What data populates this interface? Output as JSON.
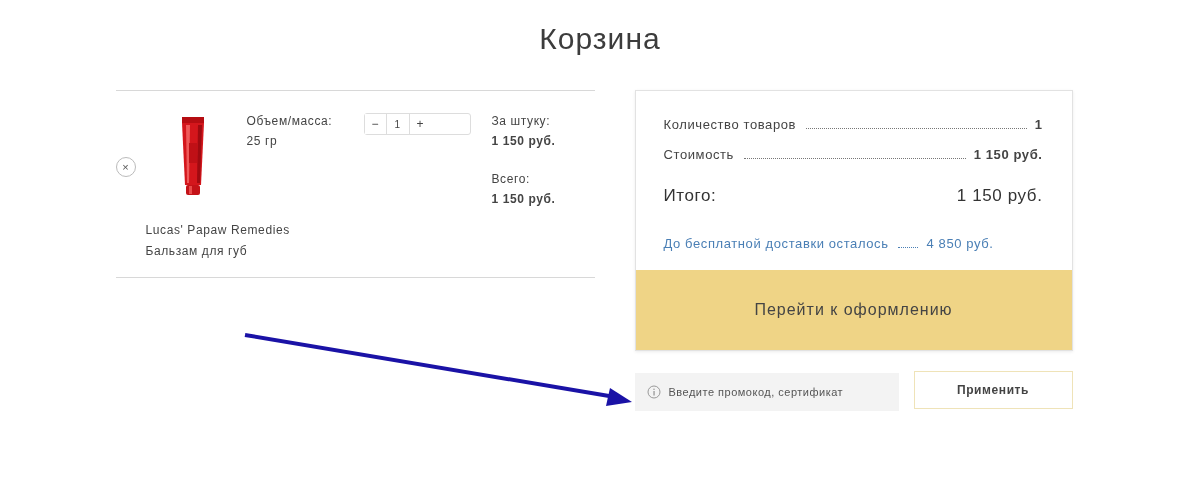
{
  "title": "Корзина",
  "cart_items": [
    {
      "remove": "×",
      "name": "Lucas' Papaw Remedies",
      "description": "Бальзам для губ",
      "attribute_label": "Объем/масса:",
      "attribute_value": "25 гр",
      "decrement": "−",
      "quantity": "1",
      "increment": "+",
      "unit_price_label": "За штуку:",
      "unit_price": "1 150 руб.",
      "total_label": "Всего:",
      "total": "1 150 руб."
    }
  ],
  "summary": {
    "rows": [
      {
        "label": "Количество товаров",
        "value": "1"
      },
      {
        "label": "Стоимость",
        "value": "1 150 руб."
      }
    ],
    "total_label": "Итого:",
    "total": "1 150 руб.",
    "free_delivery": {
      "label": "До бесплатной доставки осталось",
      "value": "4 850 руб."
    },
    "checkout_button": "Перейти к оформлению"
  },
  "promo": {
    "placeholder": "Введите промокод, сертификат",
    "apply_button": "Применить"
  }
}
